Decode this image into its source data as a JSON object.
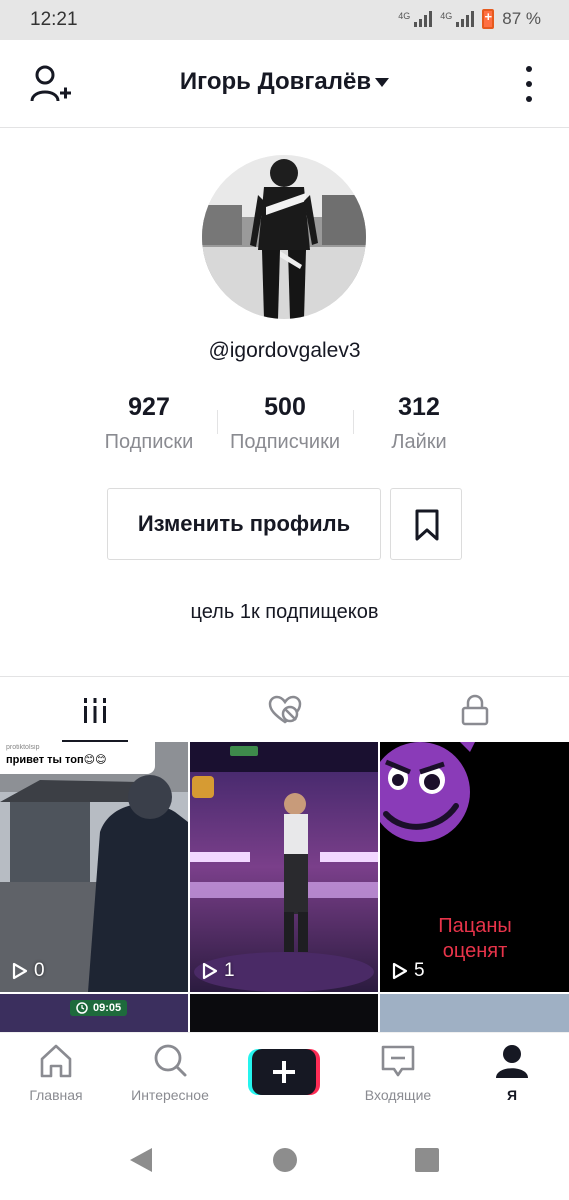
{
  "status_bar": {
    "time": "12:21",
    "network_1": "4G",
    "network_2": "4G",
    "battery": "87 %"
  },
  "header": {
    "name": "Игорь Довгалёв"
  },
  "profile": {
    "username": "@igordovgalev3",
    "stats": [
      {
        "value": "927",
        "label": "Подписки"
      },
      {
        "value": "500",
        "label": "Подписчики"
      },
      {
        "value": "312",
        "label": "Лайки"
      }
    ],
    "edit_label": "Изменить профиль",
    "bio": "цель 1к подпищеков"
  },
  "videos": [
    {
      "views": "0",
      "comment_header": "protiktolsip",
      "comment_text": "привет ты топ😊😊"
    },
    {
      "views": "1"
    },
    {
      "views": "5",
      "caption": "Пацаны оценят"
    }
  ],
  "partial_row": {
    "timer": "09:05"
  },
  "bottom_nav": {
    "items": [
      "Главная",
      "Интересное",
      "Входящие",
      "Я"
    ]
  },
  "colors": {
    "accent_red": "#fe2c55",
    "accent_cyan": "#25f4ee",
    "text": "#161823",
    "muted": "#8a8b91"
  }
}
